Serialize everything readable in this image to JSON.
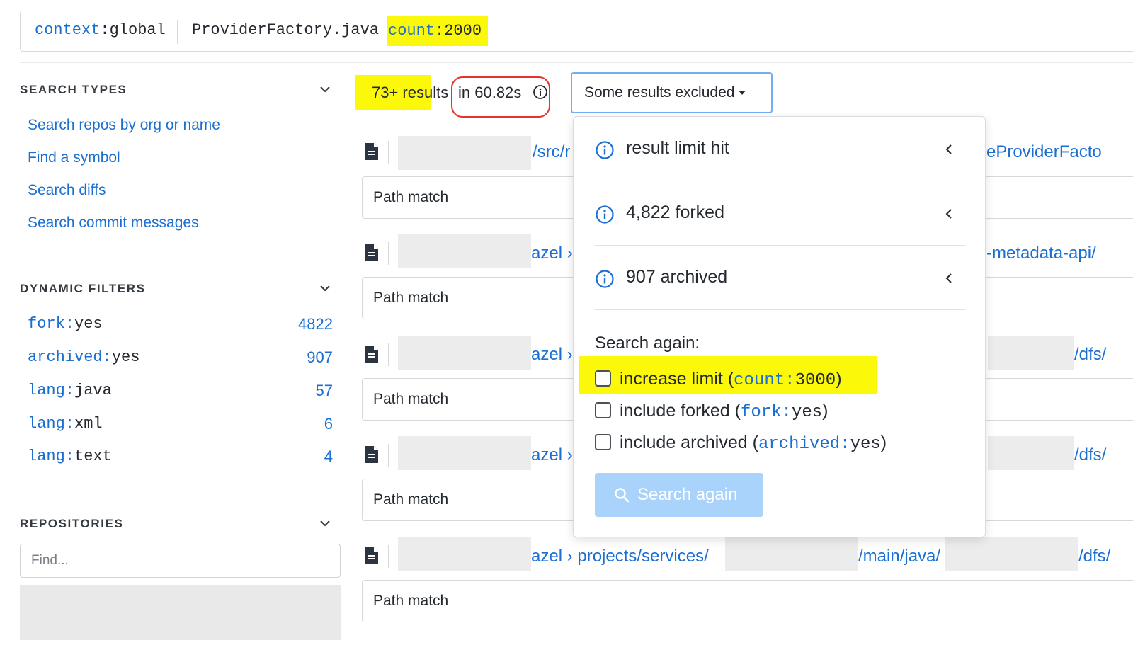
{
  "query": {
    "context_key": "context",
    "context_value": "global",
    "text": "ProviderFactory.java",
    "count_key": "count",
    "count_value": "2000",
    "colon": ":"
  },
  "sidebar": {
    "search_types": {
      "title": "SEARCH TYPES",
      "links": [
        "Search repos by org or name",
        "Find a symbol",
        "Search diffs",
        "Search commit messages"
      ]
    },
    "dynamic_filters": {
      "title": "DYNAMIC FILTERS",
      "items": [
        {
          "key": "fork",
          "value": "yes",
          "count": "4822"
        },
        {
          "key": "archived",
          "value": "yes",
          "count": "907"
        },
        {
          "key": "lang",
          "value": "java",
          "count": "57"
        },
        {
          "key": "lang",
          "value": "xml",
          "count": "6"
        },
        {
          "key": "lang",
          "value": "text",
          "count": "4"
        }
      ]
    },
    "repositories": {
      "title": "REPOSITORIES",
      "find_placeholder": "Find..."
    }
  },
  "results": {
    "count_text": "73+ results",
    "time_text": "in 60.82s",
    "excluded_button": "Some results excluded",
    "rows": [
      {
        "path_visible": "/src/r",
        "path_right": "eProviderFacto",
        "match_label": "Path match"
      },
      {
        "path_visible": "azel ›",
        "path_right": "-metadata-api/",
        "match_label": "Path match"
      },
      {
        "path_visible": "azel ›",
        "path_right": "/dfs/",
        "match_label": "Path match"
      },
      {
        "path_visible": "azel ›",
        "path_right": "/dfs/",
        "match_label": "Path match"
      },
      {
        "path_visible": "azel › projects/services/",
        "path_mid": "/main/java/",
        "path_right": "/dfs/",
        "match_label": "Path match"
      }
    ]
  },
  "dropdown": {
    "items": [
      {
        "label": "result limit hit"
      },
      {
        "label": "4,822 forked"
      },
      {
        "label": "907 archived"
      }
    ],
    "search_again_label": "Search again:",
    "options": [
      {
        "label": "increase limit (",
        "key": "count",
        "value": "3000",
        "close": ")"
      },
      {
        "label": "include forked (",
        "key": "fork",
        "value": "yes",
        "close": ")"
      },
      {
        "label": "include archived (",
        "key": "archived",
        "value": "yes",
        "close": ")"
      }
    ],
    "search_again_button": "Search again"
  },
  "colors": {
    "accent": "#1a6fd1",
    "highlight": "#fcf80a",
    "annotation_red": "#e8322d",
    "button_disabled": "#a9d3fb"
  }
}
